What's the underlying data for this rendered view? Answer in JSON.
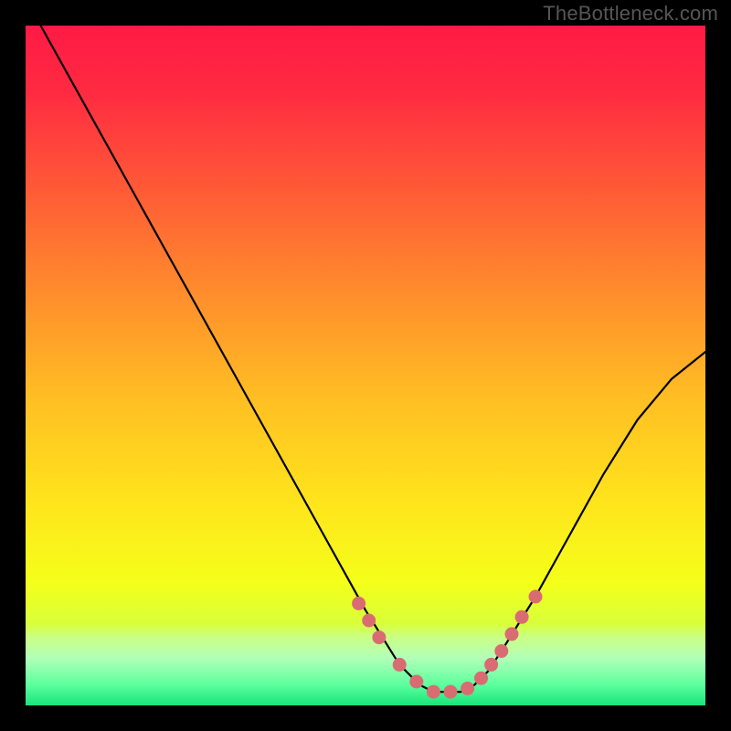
{
  "watermark": {
    "text": "TheBottleneck.com"
  },
  "chart_data": {
    "type": "line",
    "title": "",
    "xlabel": "",
    "ylabel": "",
    "xlim": [
      0,
      100
    ],
    "ylim": [
      0,
      100
    ],
    "grid": false,
    "legend": false,
    "series": [
      {
        "name": "curve",
        "x": [
          0,
          5,
          10,
          15,
          20,
          25,
          30,
          35,
          40,
          45,
          50,
          55,
          58,
          60,
          62,
          64,
          66,
          68,
          70,
          75,
          80,
          85,
          90,
          95,
          100
        ],
        "y": [
          104,
          95,
          86,
          77,
          68,
          59,
          50,
          41,
          32,
          23,
          14,
          6,
          3,
          2,
          2,
          2,
          3,
          5,
          8,
          16,
          25,
          34,
          42,
          48,
          52
        ]
      }
    ],
    "points": {
      "name": "markers",
      "x": [
        49,
        50.5,
        52,
        55,
        57.5,
        60,
        62.5,
        65,
        67,
        68.5,
        70,
        71.5,
        73,
        75
      ],
      "y": [
        15,
        12.5,
        10,
        6,
        3.5,
        2,
        2,
        2.5,
        4,
        6,
        8,
        10.5,
        13,
        16
      ]
    },
    "background_gradient": {
      "stops": [
        {
          "offset": 0.0,
          "color": "#ff1a45"
        },
        {
          "offset": 0.1,
          "color": "#ff2b41"
        },
        {
          "offset": 0.25,
          "color": "#ff5d36"
        },
        {
          "offset": 0.4,
          "color": "#ff8f2c"
        },
        {
          "offset": 0.55,
          "color": "#ffbf23"
        },
        {
          "offset": 0.7,
          "color": "#ffe41c"
        },
        {
          "offset": 0.82,
          "color": "#f4ff1a"
        },
        {
          "offset": 0.88,
          "color": "#d8ff3a"
        },
        {
          "offset": 0.9,
          "color": "#c9ff86"
        },
        {
          "offset": 0.93,
          "color": "#b2ffb8"
        },
        {
          "offset": 0.97,
          "color": "#5cff9e"
        },
        {
          "offset": 1.0,
          "color": "#18e47a"
        }
      ]
    },
    "marker_color": "#d96c72",
    "line_color": "#000000"
  }
}
